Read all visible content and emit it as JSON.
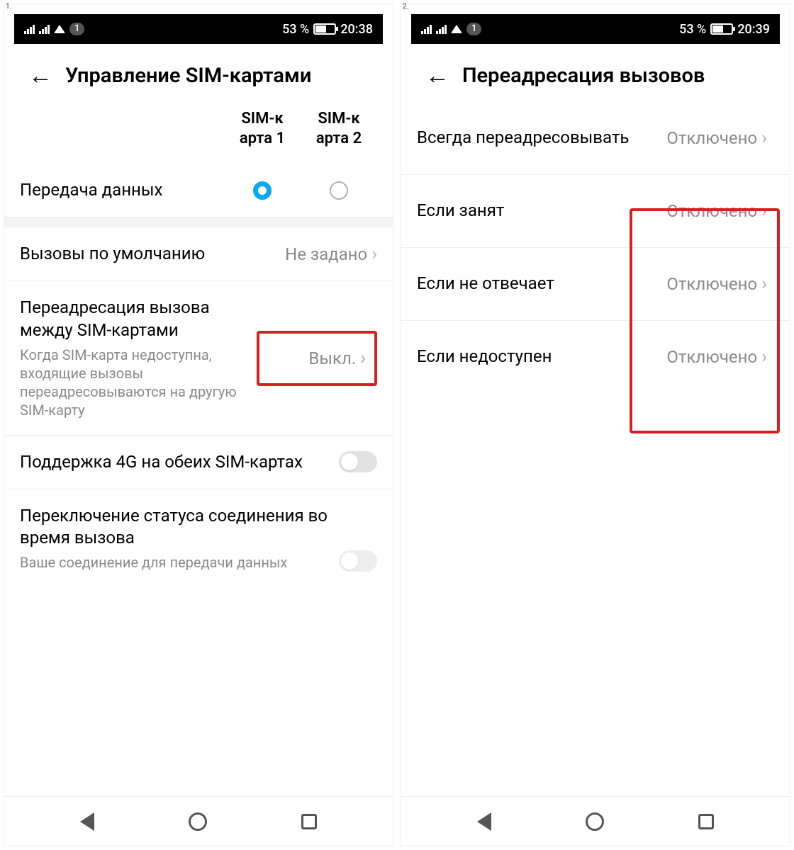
{
  "status": {
    "battery_pct_label": "53 %",
    "sim_badge": "1"
  },
  "left": {
    "num": "1.",
    "time": "20:38",
    "title": "Управление SIM-картами",
    "sim1_header": "SIM-к арта 1",
    "sim2_header": "SIM-к арта 2",
    "data_transfer_label": "Передача данных",
    "default_calls_label": "Вызовы по умолчанию",
    "default_calls_value": "Не задано",
    "call_fwd_label": "Переадресация вызова между SIM-картами",
    "call_fwd_sub": "Когда SIM-карта недоступна, входящие вызовы переадресовываются на другую SIM-карту",
    "call_fwd_value": "Выкл.",
    "support_4g_label": "Поддержка 4G на обеих SIM-картах",
    "switch_status_label": "Переключение статуса соединения во время вызова",
    "switch_status_sub": "Ваше соединение для передачи данных"
  },
  "right": {
    "num": "2.",
    "time": "20:39",
    "title": "Переадресация вызовов",
    "items": [
      {
        "label": "Всегда переадресовывать",
        "value": "Отключено"
      },
      {
        "label": "Если занят",
        "value": "Отключено"
      },
      {
        "label": "Если не отвечает",
        "value": "Отключено"
      },
      {
        "label": "Если недоступен",
        "value": "Отключено"
      }
    ]
  }
}
